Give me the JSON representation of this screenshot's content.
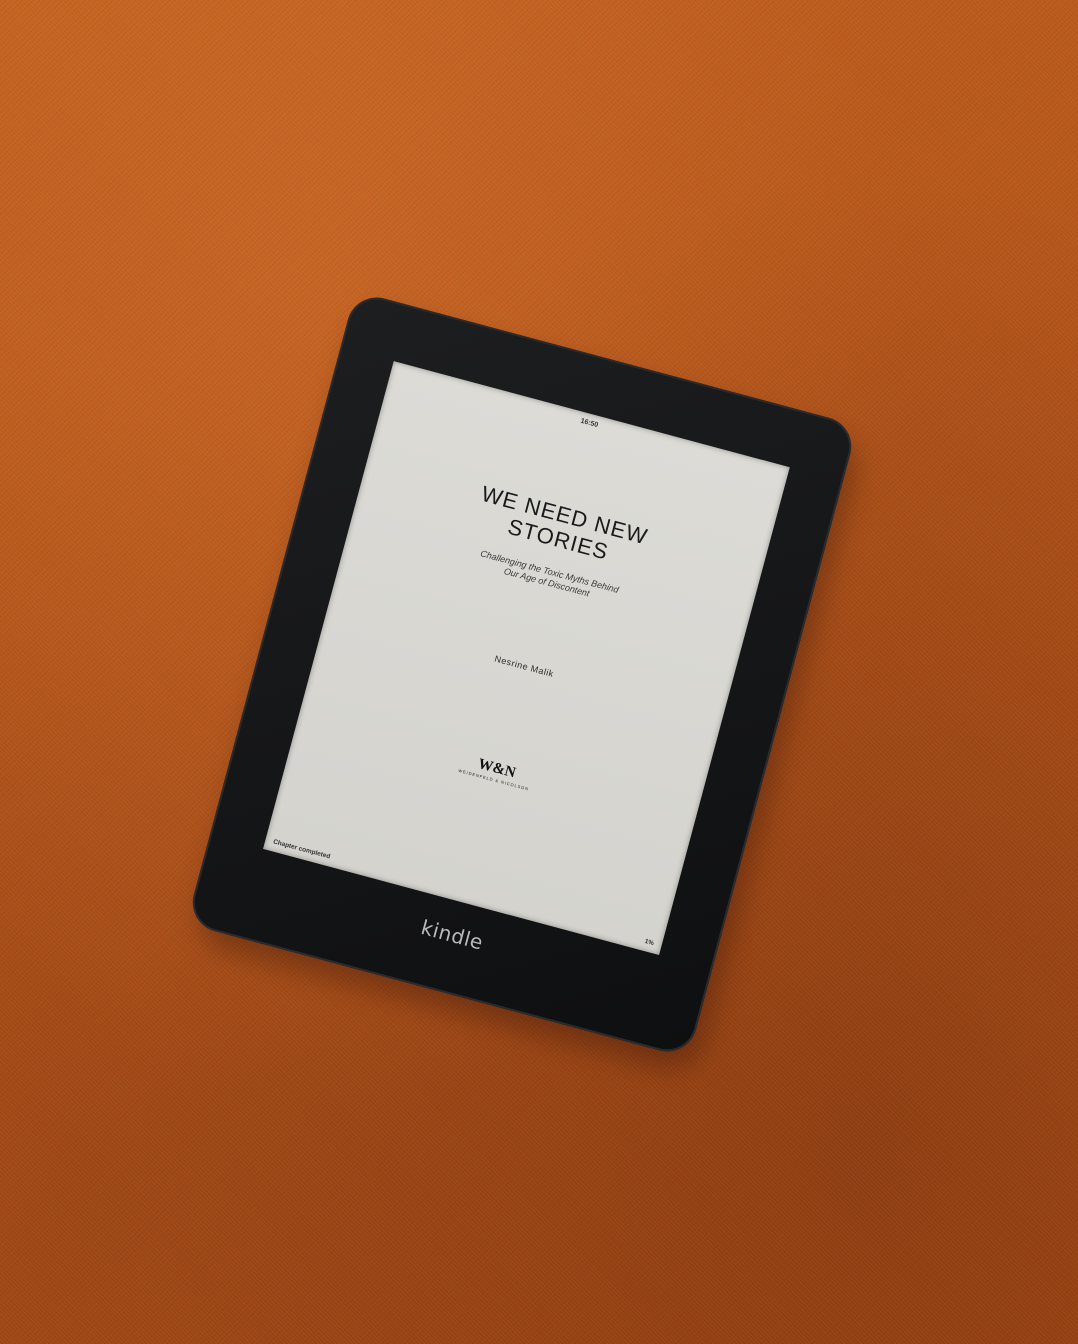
{
  "scene": {
    "background_color": "#b3541a",
    "device_color": "#161719",
    "screen_color": "#d8d7d2"
  },
  "kindle": {
    "brand": "kindle",
    "status_bar": {
      "time": "16:50"
    },
    "book": {
      "title_line1": "WE NEED NEW",
      "title_line2": "STORIES",
      "subtitle_line1": "Challenging the Toxic Myths Behind",
      "subtitle_line2": "Our Age of Discontent",
      "author": "Nesrine Malik",
      "publisher_mark": "W&N",
      "publisher_name": "WEIDENFELD & NICOLSON"
    },
    "footer": {
      "chapter_status": "Chapter completed",
      "progress": "1%"
    }
  }
}
